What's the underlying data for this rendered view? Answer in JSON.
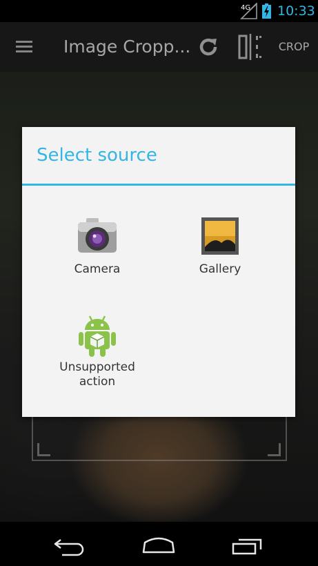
{
  "status_bar": {
    "network_label": "4G",
    "time": "10:33",
    "signal_icon": "signal-icon",
    "battery_icon": "battery-charging-icon"
  },
  "action_bar": {
    "title": "Image Cropp...",
    "menu_icon": "hamburger-menu-icon",
    "rotate_icon": "rotate-icon",
    "flip_icon": "flip-horizontal-icon",
    "crop_label": "CROP"
  },
  "dialog": {
    "title": "Select source",
    "options": [
      {
        "label": "Camera",
        "icon": "camera-icon"
      },
      {
        "label": "Gallery",
        "icon": "gallery-icon"
      },
      {
        "label_line1": "Unsupported",
        "label_line2": "action",
        "icon": "android-icon"
      }
    ]
  },
  "nav_bar": {
    "back_icon": "back-icon",
    "home_icon": "home-icon",
    "recents_icon": "recent-apps-icon"
  },
  "colors": {
    "accent": "#33b5e5",
    "action_bar": "#242424",
    "dialog_bg": "#f3f3f3",
    "text_dark": "#333333"
  }
}
